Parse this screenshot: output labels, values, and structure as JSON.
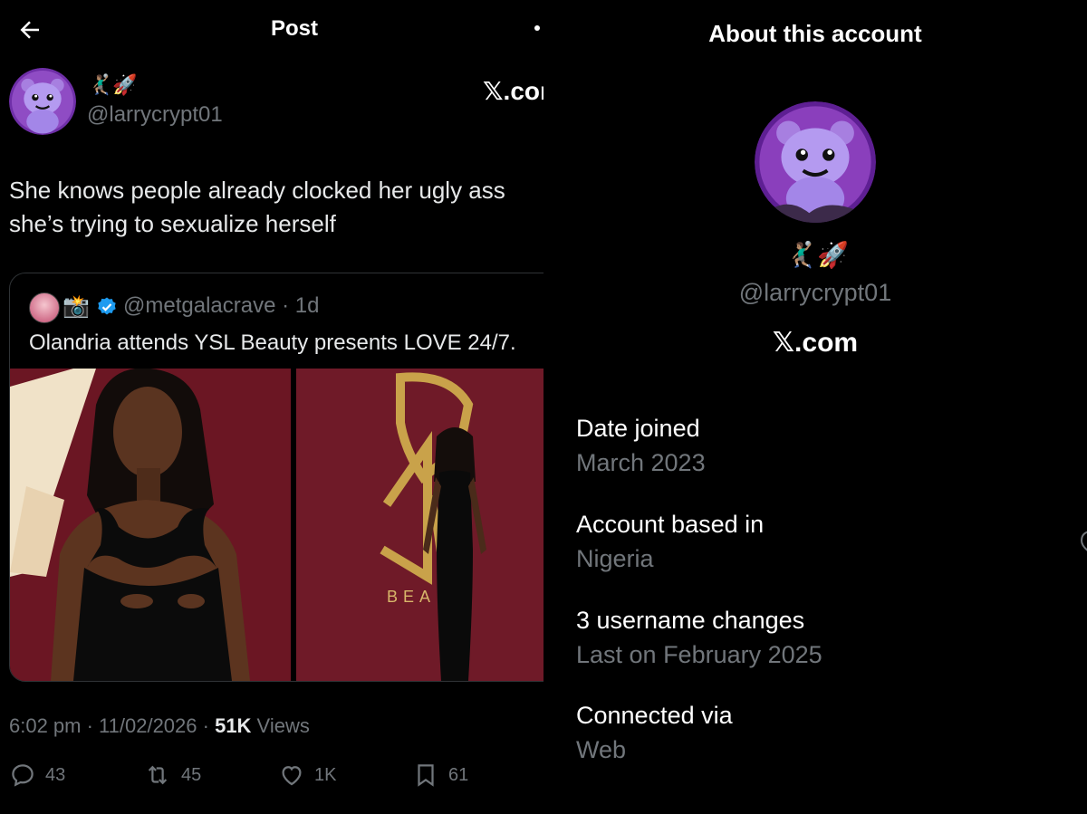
{
  "header": {
    "title": "Post"
  },
  "author": {
    "display_name": "🤾🏽‍♂️🚀",
    "handle": "@larrycrypt01",
    "platform": "𝕏.com"
  },
  "tweet": {
    "text_line1": "She knows people already clocked her ugly ass",
    "text_line2": "she’s trying to sexualize herself"
  },
  "quote": {
    "camera_emoji": "📸",
    "handle_time": "@metgalacrave · 1d",
    "text": "Olandria attends YSL Beauty presents LOVE 24/7.",
    "banner_text": "BEA"
  },
  "meta": {
    "time_date": "6:02 pm · 11/02/2026 · ",
    "views_count": "51K",
    "views_label": " Views"
  },
  "actions": {
    "replies": "43",
    "reposts": "45",
    "likes": "1K",
    "bookmarks": "61"
  },
  "about": {
    "title": "About this account",
    "display_name": "🤾🏽‍♂️🚀",
    "handle": "@larrycrypt01",
    "platform": "𝕏.com",
    "rows": [
      {
        "label": "Date joined",
        "value": "March 2023"
      },
      {
        "label": "Account based in",
        "value": "Nigeria"
      },
      {
        "label": "3 username changes",
        "value": "Last on February 2025"
      },
      {
        "label": "Connected via",
        "value": "Web"
      }
    ]
  },
  "colors": {
    "background": "#000000",
    "text_primary": "#e7e9ea",
    "text_secondary": "#71767b",
    "verified_blue": "#1d9bf0",
    "banner_maroon": "#6a1522",
    "avatar_purple": "#9b59d0"
  },
  "icons": [
    "back-arrow-icon",
    "more-dot-icon",
    "verified-badge-icon",
    "reply-icon",
    "repost-icon",
    "like-icon",
    "bookmark-icon"
  ]
}
